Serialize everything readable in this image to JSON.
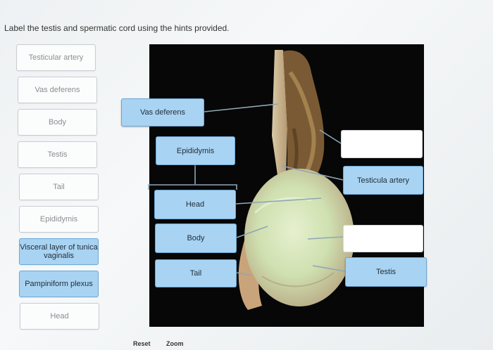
{
  "instruction": "Label the testis and spermatic cord using the hints provided.",
  "bank_items": [
    {
      "label": "Testicular artery",
      "used": false
    },
    {
      "label": "Vas deferens",
      "used": false
    },
    {
      "label": "Body",
      "used": false
    },
    {
      "label": "Testis",
      "used": false
    },
    {
      "label": "Tail",
      "used": false
    },
    {
      "label": "Epididymis",
      "used": false
    },
    {
      "label": "Visceral layer of tunica vaginalis",
      "used": true
    },
    {
      "label": "Pampiniform plexus",
      "used": true
    },
    {
      "label": "Head",
      "used": false
    }
  ],
  "placed_labels": {
    "vas_deferens": "Vas deferens",
    "epididymis": "Epididymis",
    "head": "Head",
    "body": "Body",
    "tail": "Tail",
    "testicular_artery": "Testicula artery",
    "testis": "Testis"
  },
  "controls": {
    "reset": "Reset",
    "zoom": "Zoom"
  }
}
